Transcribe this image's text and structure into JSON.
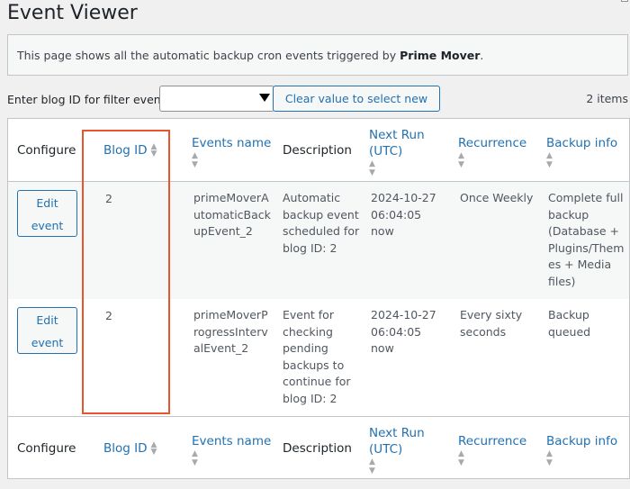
{
  "page": {
    "title": "Event Viewer"
  },
  "notice": {
    "text_before": "This page shows all the automatic backup cron events triggered by ",
    "text_bold": "Prime Mover",
    "text_after": "."
  },
  "filter": {
    "label": "Enter blog ID for filter events",
    "selected_value": "",
    "clear_button_label": "Clear value to select new site",
    "items_count": "2 items"
  },
  "table": {
    "columns": {
      "configure": "Configure",
      "blog_id": "Blog ID",
      "events_name": "Events name",
      "description": "Description",
      "next_run_line1": "Next Run",
      "next_run_line2": "(UTC)",
      "recurrence": "Recurrence",
      "backup_info": "Backup info"
    },
    "sort_indicator": "▲▼",
    "rows": [
      {
        "edit_label_1": "Edit",
        "edit_label_2": "event",
        "blog_id": "2",
        "events_name": [
          "primeMoverA",
          "utomaticBack",
          "upEvent_2"
        ],
        "description": [
          "Automatic",
          "backup event",
          "scheduled for",
          "blog ID: 2"
        ],
        "next_run": [
          "2024-10-27",
          "06:04:05",
          "now"
        ],
        "recurrence": [
          "Once Weekly"
        ],
        "backup_info": [
          "Complete full",
          "backup",
          "(Database +",
          "Plugins/Them",
          "es + Media",
          "files)"
        ]
      },
      {
        "edit_label_1": "Edit",
        "edit_label_2": "event",
        "blog_id": "2",
        "events_name": [
          "primeMoverP",
          "rogressInterv",
          "alEvent_2"
        ],
        "description": [
          "Event for",
          "checking",
          "pending",
          "backups to",
          "continue for",
          "blog ID: 2"
        ],
        "next_run": [
          "2024-10-27",
          "06:04:05",
          "now"
        ],
        "recurrence": [
          "Every sixty",
          "seconds"
        ],
        "backup_info": [
          "Backup",
          "queued"
        ]
      }
    ]
  },
  "colors": {
    "link": "#2271b1",
    "highlight": "#e8542d",
    "stripe": "#f6f7f7"
  }
}
